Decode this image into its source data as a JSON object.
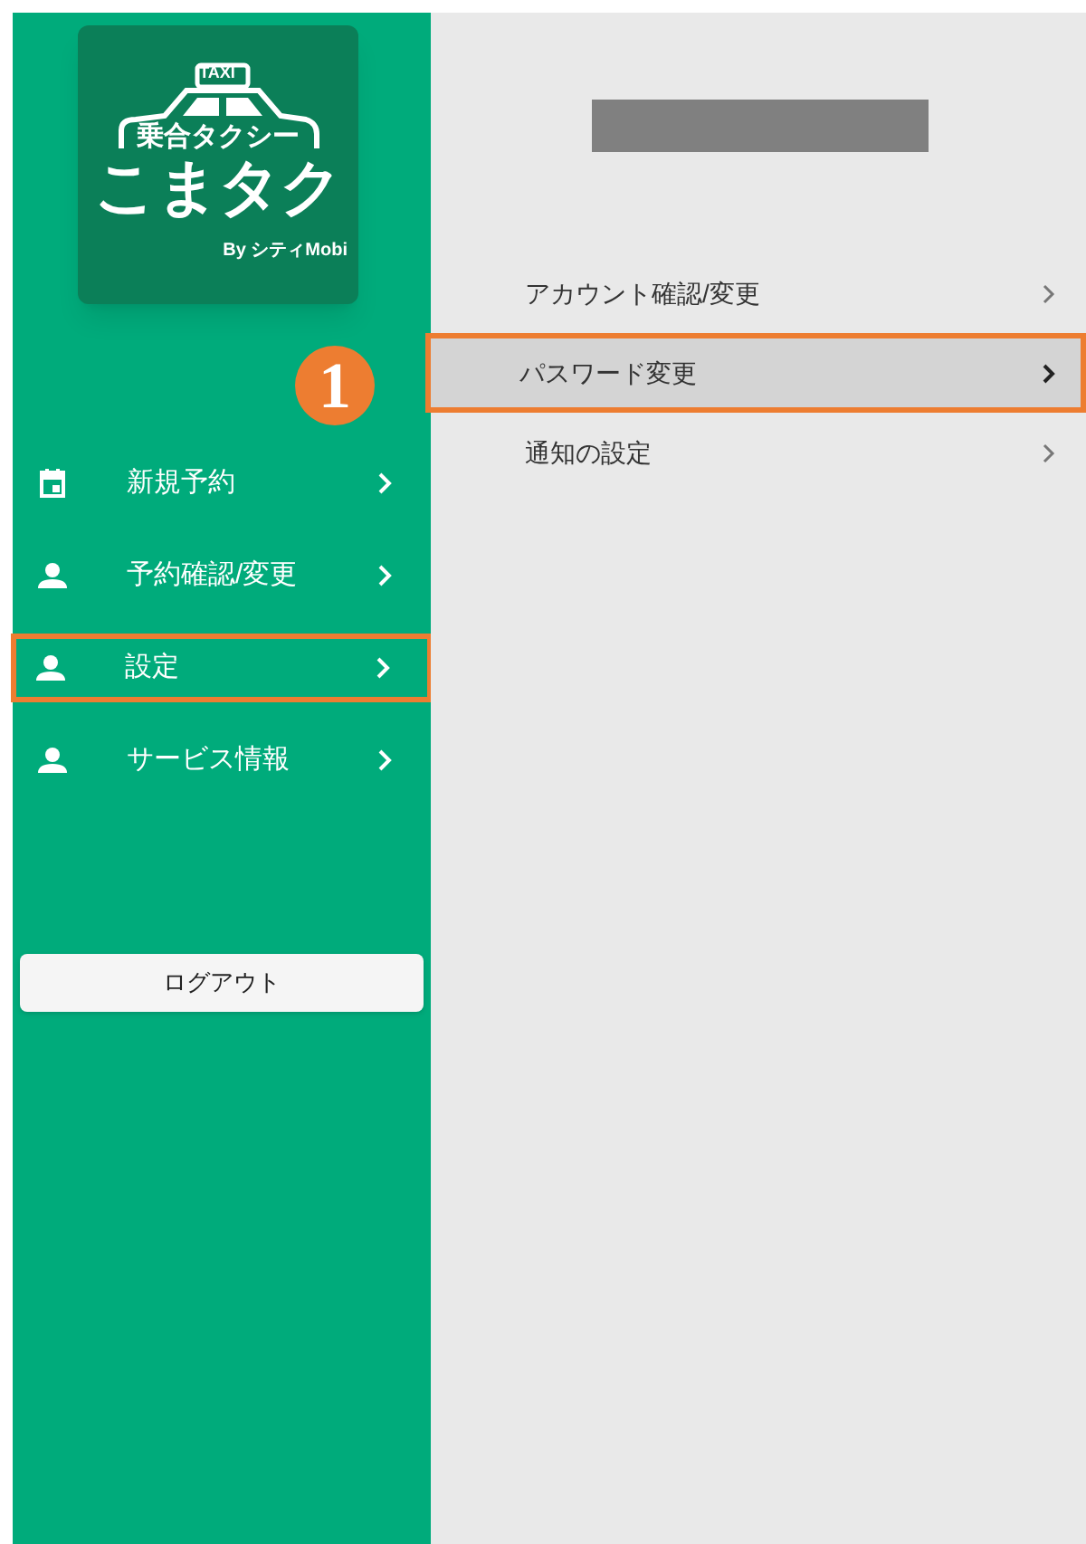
{
  "logo": {
    "sign": "TAXI",
    "subtitle": "乗合タクシー",
    "name": "こまタク",
    "byline": "By シティMobi"
  },
  "annotation": {
    "number": "1"
  },
  "sidebar": {
    "items": [
      {
        "label": "新規予約",
        "kind": "calendar",
        "selected": false
      },
      {
        "label": "予約確認/変更",
        "kind": "person",
        "selected": false
      },
      {
        "label": "設定",
        "kind": "person",
        "selected": true
      },
      {
        "label": "サービス情報",
        "kind": "person",
        "selected": false
      }
    ],
    "logout": "ログアウト"
  },
  "settings_menu": [
    {
      "label": "アカウント確認/変更",
      "selected": false
    },
    {
      "label": "パスワード変更",
      "selected": true
    },
    {
      "label": "通知の設定",
      "selected": false
    }
  ]
}
